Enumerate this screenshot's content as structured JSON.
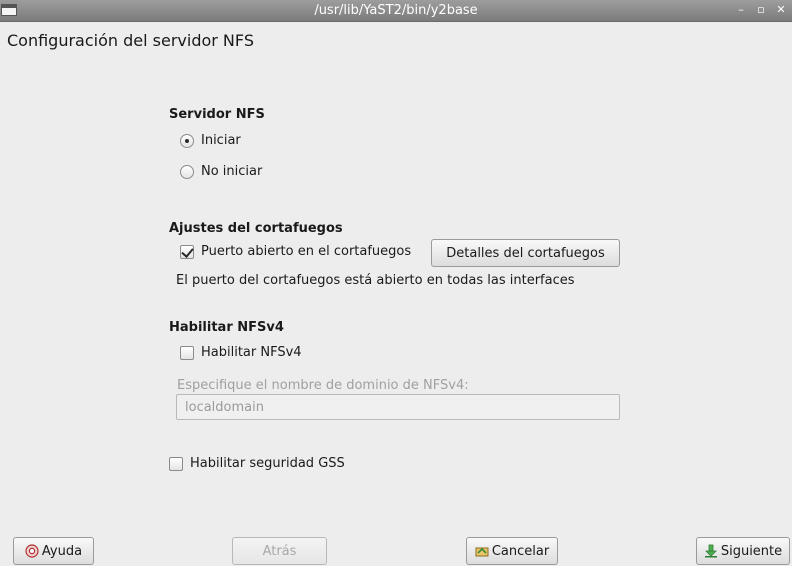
{
  "window": {
    "title": "/usr/lib/YaST2/bin/y2base",
    "minimize_glyph": "–",
    "maximize_glyph": "▫",
    "close_glyph": "✕"
  },
  "page": {
    "title": "Configuración del servidor NFS"
  },
  "server": {
    "heading": "Servidor NFS",
    "options": [
      {
        "label": "Iniciar",
        "selected": true
      },
      {
        "label": "No iniciar",
        "selected": false
      }
    ]
  },
  "firewall": {
    "heading": "Ajustes del cortafuegos",
    "open_port_label": "Puerto abierto en el cortafuegos",
    "open_port_checked": true,
    "details_button": "Detalles del cortafuegos",
    "status_text": "El puerto del cortafuegos está abierto en todas las interfaces"
  },
  "nfsv4": {
    "heading": "Habilitar NFSv4",
    "enable_label": "Habilitar NFSv4",
    "enable_checked": false,
    "domain_label": "Especifique el nombre de dominio de NFSv4:",
    "domain_value": "localdomain"
  },
  "gss": {
    "label": "Habilitar seguridad GSS",
    "checked": false
  },
  "buttons": {
    "help": "Ayuda",
    "back": "Atrás",
    "cancel": "Cancelar",
    "next": "Siguiente"
  },
  "icons": {
    "help": "help-icon",
    "cancel": "cancel-icon",
    "next": "next-icon",
    "app": "window-icon"
  }
}
